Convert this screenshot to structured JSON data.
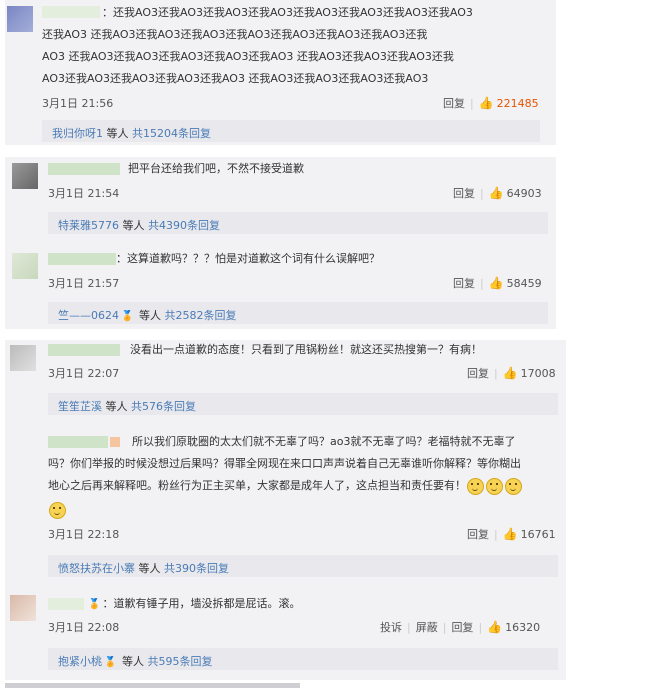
{
  "comments": [
    {
      "username": "",
      "text_lines": [
        "：还我AO3还我AO3还我AO3还我AO3还我AO3还我AO3还我AO3还我AO3",
        "还我AO3 还我AO3还我AO3还我AO3还我AO3还我AO3还我AO3还我AO3还我",
        "AO3 还我AO3还我AO3还我AO3还我AO3还我AO3 还我AO3还我AO3还我AO3还我",
        "AO3还我AO3还我AO3还我AO3还我AO3 还我AO3还我AO3还我AO3还我AO3"
      ],
      "date": "3月1日 21:56",
      "reply_label": "回复",
      "likes": "221485",
      "liked": true,
      "sub_reply": {
        "name": "我归你呀1",
        "suffix": " 等人 ",
        "count_text": "共15204条回复"
      }
    },
    {
      "username": "",
      "text_lines": [
        "把平台还给我们吧，不然不接受道歉"
      ],
      "date": "3月1日 21:54",
      "reply_label": "回复",
      "likes": "64903",
      "liked": false,
      "sub_reply": {
        "name": "特莱雅5776",
        "suffix": " 等人 ",
        "count_text": "共4390条回复"
      }
    },
    {
      "username": "",
      "text_lines": [
        "：这算道歉吗？？？怕是对道歉这个词有什么误解吧？"
      ],
      "date": "3月1日 21:57",
      "reply_label": "回复",
      "likes": "58459",
      "liked": false,
      "sub_reply": {
        "name": "竺——0624",
        "suffix": " 等人 ",
        "count_text": "共2582条回复"
      }
    },
    {
      "username": "",
      "text_lines": [
        "没看出一点道歉的态度！只看到了甩锅粉丝！就这还买热搜第一？有病！"
      ],
      "date": "3月1日 22:07",
      "reply_label": "回复",
      "likes": "17008",
      "liked": false,
      "sub_reply": {
        "name": "笙笙芷溪",
        "suffix": " 等人 ",
        "count_text": "共576条回复"
      }
    },
    {
      "username": "",
      "text_lines": [
        "所以我们原耽圈的太太们就不无辜了吗？ao3就不无辜了吗？老福特就不无辜了",
        "吗？你们举报的时候没想过后果吗？得罪全网现在来口口声声说着自己无辜谁听你解释？等你糊出",
        "地心之后再来解释吧。粉丝行为正主买单，大家都是成年人了，这点担当和责任要有！"
      ],
      "date": "3月1日 22:18",
      "reply_label": "回复",
      "likes": "16761",
      "liked": false,
      "sub_reply": {
        "name": "愤怒扶苏在小寨",
        "suffix": " 等人 ",
        "count_text": "共390条回复"
      }
    },
    {
      "username": "",
      "text_lines": [
        "：道歉有锤子用，墙没拆都是屁话。滚。"
      ],
      "date": "3月1日 22:08",
      "report_label": "投诉",
      "block_label": "屏蔽",
      "reply_label": "回复",
      "likes": "16320",
      "liked": false,
      "sub_reply": {
        "name": "抱紧小桃",
        "suffix": " 等人 ",
        "count_text": "共595条回复"
      }
    }
  ],
  "colors": {
    "link": "#4a7bb5",
    "liked": "#e65400",
    "card_bg": "#f2f2f5"
  },
  "icons": {
    "like": "thumbs-up-icon",
    "medal": "medal-icon",
    "emoji": "smile-emoji-icon"
  }
}
